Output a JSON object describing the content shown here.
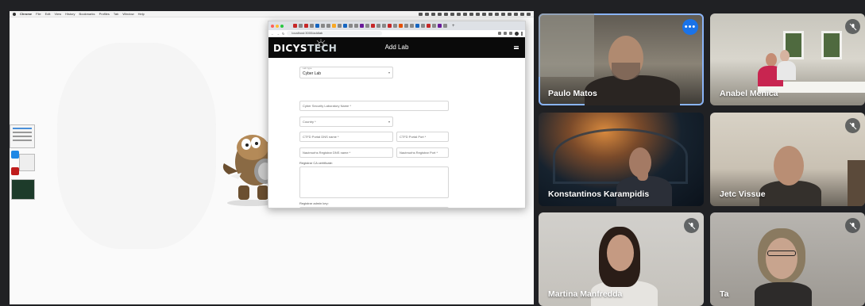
{
  "shared_screen": {
    "mac_menubar": {
      "items": [
        "Chrome",
        "File",
        "Edit",
        "View",
        "History",
        "Bookmarks",
        "Profiles",
        "Tab",
        "Window",
        "Help"
      ]
    },
    "browser": {
      "url": "localhost:3000/addlab",
      "app": {
        "brand_part1": "DICYS",
        "brand_part2": "TECH",
        "page_title": "Add Lab"
      },
      "form": {
        "lab_type": {
          "label": "Lab type",
          "value": "Cyber Lab"
        },
        "lab_name": {
          "placeholder": "Cyber Security Laboratory Name *"
        },
        "country": {
          "placeholder": "Country *"
        },
        "ctfd_dns": {
          "placeholder": "CTFD Portal DNS name *"
        },
        "ctfd_port": {
          "placeholder": "CTFD Portal Port *"
        },
        "registrar_dns": {
          "placeholder": "Nautmurhs Registrar DNS name *"
        },
        "registrar_port": {
          "placeholder": "Nautmurhs Registrar Port *"
        },
        "registrar_ca_label": "Registrar CA certificate:",
        "registrar_admin_label": "Registrar admin key:"
      }
    }
  },
  "participants": [
    {
      "name": "Paulo Matos",
      "muted": false,
      "active": true
    },
    {
      "name": "Anabel Menica",
      "muted": true,
      "active": false
    },
    {
      "name": "Konstantinos Karampidis",
      "muted": false,
      "active": false
    },
    {
      "name": "Jetc Vissue",
      "muted": true,
      "active": false
    },
    {
      "name": "Martina Manfredda",
      "muted": true,
      "active": false
    },
    {
      "name": "Ta",
      "muted": true,
      "active": false
    }
  ],
  "colors": {
    "background": "#202124",
    "active_outline": "#8ab4f8",
    "more_button": "#1a73e8"
  }
}
